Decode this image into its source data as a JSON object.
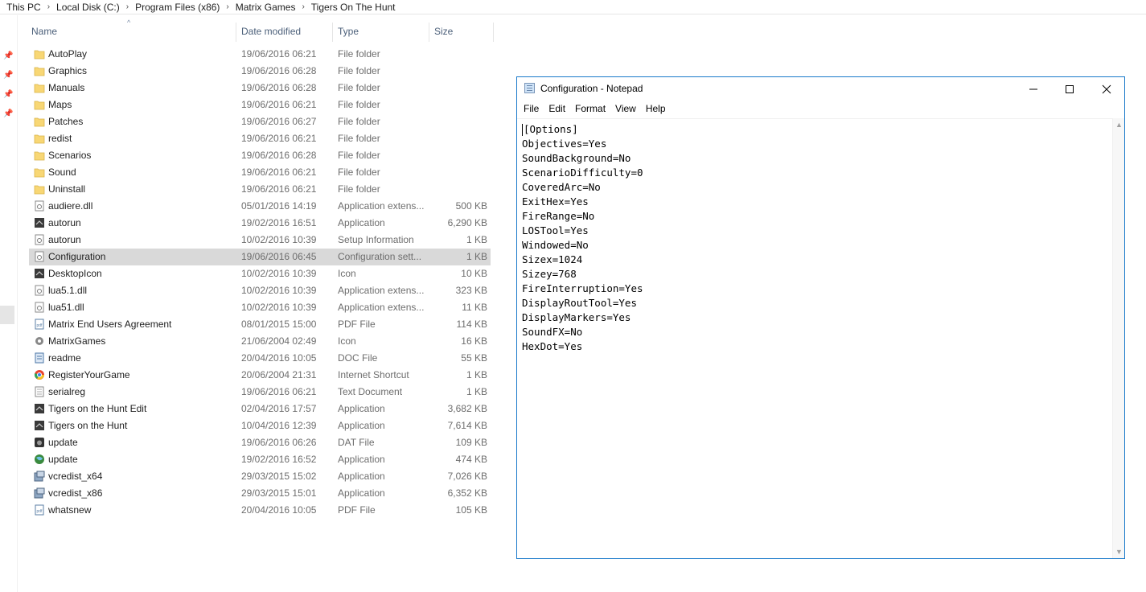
{
  "breadcrumb": [
    "This PC",
    "Local Disk (C:)",
    "Program Files (x86)",
    "Matrix Games",
    "Tigers On The Hunt"
  ],
  "columns": {
    "name": "Name",
    "date": "Date modified",
    "type": "Type",
    "size": "Size"
  },
  "files": [
    {
      "name": "AutoPlay",
      "date": "19/06/2016 06:21",
      "type": "File folder",
      "size": "",
      "icon": "folder-icon"
    },
    {
      "name": "Graphics",
      "date": "19/06/2016 06:28",
      "type": "File folder",
      "size": "",
      "icon": "folder-icon"
    },
    {
      "name": "Manuals",
      "date": "19/06/2016 06:28",
      "type": "File folder",
      "size": "",
      "icon": "folder-icon"
    },
    {
      "name": "Maps",
      "date": "19/06/2016 06:21",
      "type": "File folder",
      "size": "",
      "icon": "folder-icon"
    },
    {
      "name": "Patches",
      "date": "19/06/2016 06:27",
      "type": "File folder",
      "size": "",
      "icon": "folder-icon"
    },
    {
      "name": "redist",
      "date": "19/06/2016 06:21",
      "type": "File folder",
      "size": "",
      "icon": "folder-icon"
    },
    {
      "name": "Scenarios",
      "date": "19/06/2016 06:28",
      "type": "File folder",
      "size": "",
      "icon": "folder-icon"
    },
    {
      "name": "Sound",
      "date": "19/06/2016 06:21",
      "type": "File folder",
      "size": "",
      "icon": "folder-icon"
    },
    {
      "name": "Uninstall",
      "date": "19/06/2016 06:21",
      "type": "File folder",
      "size": "",
      "icon": "folder-icon"
    },
    {
      "name": "audiere.dll",
      "date": "05/01/2016 14:19",
      "type": "Application extens...",
      "size": "500 KB",
      "icon": "dll-icon"
    },
    {
      "name": "autorun",
      "date": "19/02/2016 16:51",
      "type": "Application",
      "size": "6,290 KB",
      "icon": "app-icon"
    },
    {
      "name": "autorun",
      "date": "10/02/2016 10:39",
      "type": "Setup Information",
      "size": "1 KB",
      "icon": "setup-icon"
    },
    {
      "name": "Configuration",
      "date": "19/06/2016 06:45",
      "type": "Configuration sett...",
      "size": "1 KB",
      "icon": "config-icon",
      "selected": true
    },
    {
      "name": "DesktopIcon",
      "date": "10/02/2016 10:39",
      "type": "Icon",
      "size": "10 KB",
      "icon": "app-icon"
    },
    {
      "name": "lua5.1.dll",
      "date": "10/02/2016 10:39",
      "type": "Application extens...",
      "size": "323 KB",
      "icon": "dll-icon"
    },
    {
      "name": "lua51.dll",
      "date": "10/02/2016 10:39",
      "type": "Application extens...",
      "size": "11 KB",
      "icon": "dll-icon"
    },
    {
      "name": "Matrix End Users Agreement",
      "date": "08/01/2015 15:00",
      "type": "PDF File",
      "size": "114 KB",
      "icon": "pdf-icon"
    },
    {
      "name": "MatrixGames",
      "date": "21/06/2004 02:49",
      "type": "Icon",
      "size": "16 KB",
      "icon": "gear-icon"
    },
    {
      "name": "readme",
      "date": "20/04/2016 10:05",
      "type": "DOC File",
      "size": "55 KB",
      "icon": "doc-icon"
    },
    {
      "name": "RegisterYourGame",
      "date": "20/06/2004 21:31",
      "type": "Internet Shortcut",
      "size": "1 KB",
      "icon": "browser-icon"
    },
    {
      "name": "serialreg",
      "date": "19/06/2016 06:21",
      "type": "Text Document",
      "size": "1 KB",
      "icon": "text-icon"
    },
    {
      "name": "Tigers on the Hunt Edit",
      "date": "02/04/2016 17:57",
      "type": "Application",
      "size": "3,682 KB",
      "icon": "app-icon"
    },
    {
      "name": "Tigers on the Hunt",
      "date": "10/04/2016 12:39",
      "type": "Application",
      "size": "7,614 KB",
      "icon": "app-icon"
    },
    {
      "name": "update",
      "date": "19/06/2016 06:26",
      "type": "DAT File",
      "size": "109 KB",
      "icon": "camera-icon"
    },
    {
      "name": "update",
      "date": "19/02/2016 16:52",
      "type": "Application",
      "size": "474 KB",
      "icon": "globe-icon"
    },
    {
      "name": "vcredist_x64",
      "date": "29/03/2015 15:02",
      "type": "Application",
      "size": "7,026 KB",
      "icon": "installer-icon"
    },
    {
      "name": "vcredist_x86",
      "date": "29/03/2015 15:01",
      "type": "Application",
      "size": "6,352 KB",
      "icon": "installer-icon"
    },
    {
      "name": "whatsnew",
      "date": "20/04/2016 10:05",
      "type": "PDF File",
      "size": "105 KB",
      "icon": "pdf-icon"
    }
  ],
  "notepad": {
    "title": "Configuration - Notepad",
    "menu": [
      "File",
      "Edit",
      "Format",
      "View",
      "Help"
    ],
    "content": "[Options]\nObjectives=Yes\nSoundBackground=No\nScenarioDifficulty=0\nCoveredArc=No\nExitHex=Yes\nFireRange=No\nLOSTool=Yes\nWindowed=No\nSizex=1024\nSizey=768\nFireInterruption=Yes\nDisplayRoutTool=Yes\nDisplayMarkers=Yes\nSoundFX=No\nHexDot=Yes"
  },
  "colors": {
    "accent": "#1979ca",
    "selection": "#d9d9d9",
    "folder": "#f8d775"
  }
}
